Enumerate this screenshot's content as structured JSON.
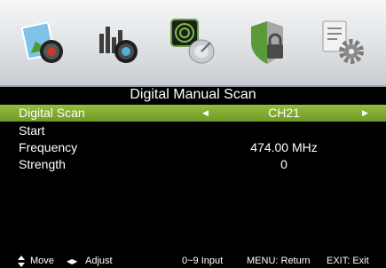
{
  "menu": {
    "tabs": [
      {
        "icon": "picture-icon",
        "active": false
      },
      {
        "icon": "sound-icon",
        "active": false
      },
      {
        "icon": "channel-icon",
        "active": true
      },
      {
        "icon": "lock-icon",
        "active": false
      },
      {
        "icon": "setup-icon",
        "active": false
      }
    ]
  },
  "page": {
    "title": "Digital Manual Scan"
  },
  "rows": [
    {
      "label": "Digital Scan",
      "value": "CH21",
      "selected": true
    },
    {
      "label": "Start",
      "value": ""
    },
    {
      "label": "Frequency",
      "value": "474.00 MHz"
    },
    {
      "label": "Strength",
      "value": "0"
    }
  ],
  "footer": {
    "move": "Move",
    "adjust": "Adjust",
    "input": "0~9 Input",
    "return": "MENU: Return",
    "exit": "EXIT: Exit"
  },
  "colors": {
    "selected_row": "#7fa832",
    "background": "#000000",
    "tab_bar": "#e2e5e8"
  }
}
